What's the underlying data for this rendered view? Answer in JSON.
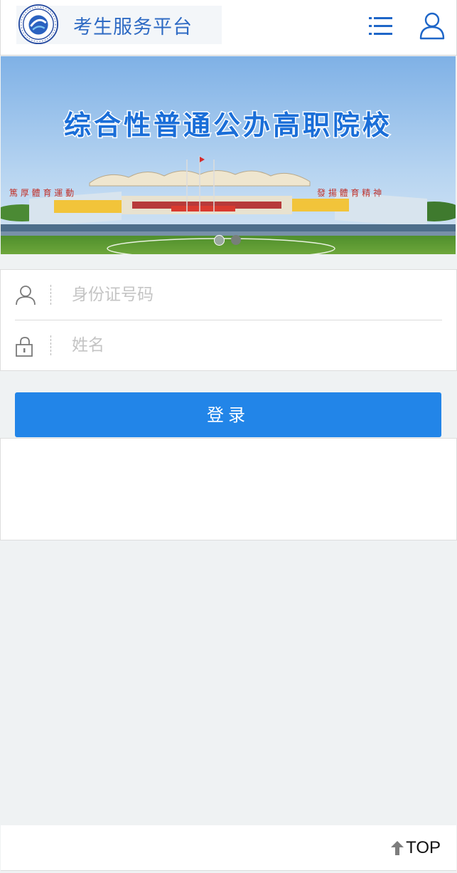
{
  "header": {
    "site_title": "考生服务平台",
    "icons": {
      "logo": "school-logo-icon",
      "menu": "menu-list-icon",
      "user": "user-icon"
    }
  },
  "banner": {
    "headline": "综合性普通公办高职院校",
    "slide_count": 2,
    "active_slide": 1
  },
  "login_form": {
    "id_placeholder": "身份证号码",
    "name_placeholder": "姓名",
    "id_icon": "user-outline-icon",
    "name_icon": "lock-icon",
    "submit_label": "登录"
  },
  "footer": {
    "top_label": "TOP",
    "top_icon": "arrow-up-icon"
  },
  "colors": {
    "brand_blue": "#2f6bc4",
    "button_blue": "#2285e8",
    "page_bg": "#eff2f3"
  }
}
